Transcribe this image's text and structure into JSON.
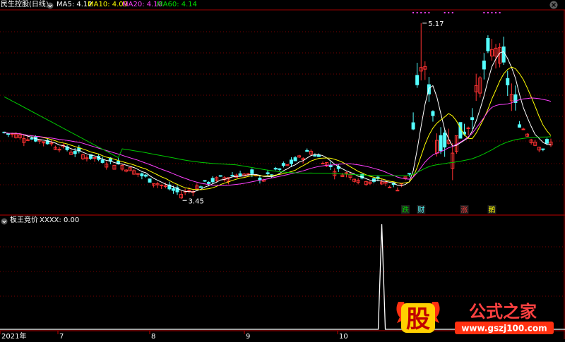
{
  "header": {
    "title": "民生控股(日线)",
    "ma_labels": [
      {
        "text": "MA5: 4.12",
        "color": "#ffffff"
      },
      {
        "text": "MA10: 4.09",
        "color": "#ffff00"
      },
      {
        "text": "MA20: 4.10",
        "color": "#ff40ff"
      },
      {
        "text": "MA60: 4.14",
        "color": "#00e000"
      }
    ]
  },
  "sub_header": {
    "indicator": "板王竞价",
    "value_label": "XXXX: 0.00",
    "value_color": "#ffffff"
  },
  "colors": {
    "up": "#ff3232",
    "down": "#54ffff",
    "ma5": "#ffffff",
    "ma10": "#ffff00",
    "ma20": "#ff40ff",
    "ma60": "#00c800",
    "grid": "#7a0000",
    "indicator": "#ffffff"
  },
  "chart_data": [
    {
      "type": "candlestick",
      "title": "民生控股(日线)",
      "ylim": [
        3.3,
        5.3
      ],
      "annotations": [
        {
          "text": "5.17",
          "at": "high"
        },
        {
          "text": "3.45",
          "at": "low"
        }
      ],
      "x_ticks": [
        "2021年",
        "7",
        "8",
        "9",
        "10"
      ],
      "markers": [
        {
          "text": "跌",
          "color": "#00c800"
        },
        {
          "text": "财",
          "color": "#54ffff"
        },
        {
          "text": "涨",
          "color": "#ff4040"
        },
        {
          "text": "鹅",
          "color": "#ffff00"
        }
      ],
      "series": [
        {
          "name": "MA5",
          "color": "#ffffff"
        },
        {
          "name": "MA10",
          "color": "#ffff00"
        },
        {
          "name": "MA20",
          "color": "#ff40ff"
        },
        {
          "name": "MA60",
          "color": "#00c800"
        }
      ]
    },
    {
      "type": "line",
      "title": "板王竞价",
      "series": [
        {
          "name": "XXXX"
        }
      ],
      "spike_value": 1
    }
  ],
  "watermark": {
    "left_char": "股",
    "brand": "公式之家",
    "url": "www.gszj100.com"
  }
}
